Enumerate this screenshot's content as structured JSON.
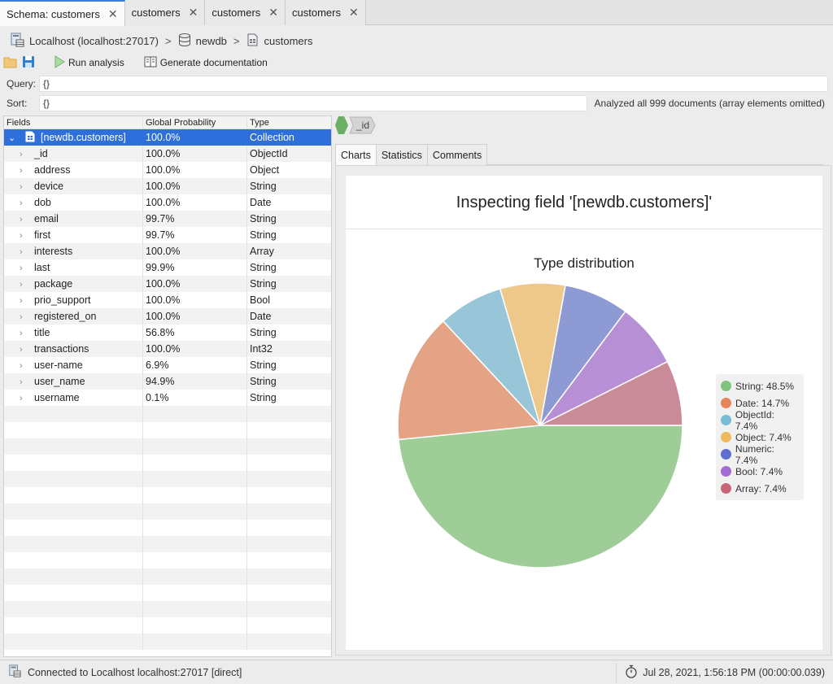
{
  "tabs": [
    {
      "label": "Schema: customers",
      "active": true
    },
    {
      "label": "customers",
      "active": false
    },
    {
      "label": "customers",
      "active": false
    },
    {
      "label": "customers",
      "active": false
    }
  ],
  "breadcrumb": {
    "server": "Localhost (localhost:27017)",
    "database": "newdb",
    "collection": "customers"
  },
  "toolbar": {
    "run_analysis": "Run analysis",
    "generate_documentation": "Generate documentation"
  },
  "query": {
    "label": "Query:",
    "value": "{}"
  },
  "sort": {
    "label": "Sort:",
    "value": "{}"
  },
  "analyzed_text": "Analyzed all 999 documents (array elements omitted)",
  "fields_table": {
    "headers": [
      "Fields",
      "Global Probability",
      "Type"
    ],
    "root": {
      "name": "[newdb.customers]",
      "probability": "100.0%",
      "type": "Collection"
    },
    "rows": [
      {
        "name": "_id",
        "probability": "100.0%",
        "type": "ObjectId"
      },
      {
        "name": "address",
        "probability": "100.0%",
        "type": "Object"
      },
      {
        "name": "device",
        "probability": "100.0%",
        "type": "String"
      },
      {
        "name": "dob",
        "probability": "100.0%",
        "type": "Date"
      },
      {
        "name": "email",
        "probability": "99.7%",
        "type": "String"
      },
      {
        "name": "first",
        "probability": "99.7%",
        "type": "String"
      },
      {
        "name": "interests",
        "probability": "100.0%",
        "type": "Array"
      },
      {
        "name": "last",
        "probability": "99.9%",
        "type": "String"
      },
      {
        "name": "package",
        "probability": "100.0%",
        "type": "String"
      },
      {
        "name": "prio_support",
        "probability": "100.0%",
        "type": "Bool"
      },
      {
        "name": "registered_on",
        "probability": "100.0%",
        "type": "Date"
      },
      {
        "name": "title",
        "probability": "56.8%",
        "type": "String"
      },
      {
        "name": "transactions",
        "probability": "100.0%",
        "type": "Int32"
      },
      {
        "name": "user-name",
        "probability": "6.9%",
        "type": "String"
      },
      {
        "name": "user_name",
        "probability": "94.9%",
        "type": "String"
      },
      {
        "name": "username",
        "probability": "0.1%",
        "type": "String"
      }
    ]
  },
  "field_path": {
    "segment": "_id"
  },
  "right_tabs": [
    {
      "label": "Charts",
      "active": true
    },
    {
      "label": "Statistics",
      "active": false
    },
    {
      "label": "Comments",
      "active": false
    }
  ],
  "inspect_title": "Inspecting field '[newdb.customers]'",
  "chart_data": {
    "type": "pie",
    "title": "Type distribution",
    "categories": [
      "String",
      "Date",
      "ObjectId",
      "Object",
      "Numeric",
      "Bool",
      "Array"
    ],
    "values": [
      48.5,
      14.7,
      7.4,
      7.4,
      7.4,
      7.4,
      7.4
    ],
    "legend_labels": [
      "String: 48.5%",
      "Date: 14.7%",
      "ObjectId: 7.4%",
      "Object: 7.4%",
      "Numeric: 7.4%",
      "Bool: 7.4%",
      "Array: 7.4%"
    ],
    "colors": [
      "#9fcd98",
      "#e4a385",
      "#98c6d8",
      "#edc88a",
      "#8e9ad4",
      "#b68fd4",
      "#c98a9a"
    ],
    "legend_dot_colors": [
      "#7fc47a",
      "#e8845a",
      "#78bcd6",
      "#efb95e",
      "#5f6fd0",
      "#a36ad4",
      "#c96577"
    ],
    "legend": "right",
    "start_direction": "right",
    "direction": "clockwise"
  },
  "status": {
    "connection": "Connected to Localhost localhost:27017 [direct]",
    "timestamp": "Jul 28, 2021, 1:56:18 PM (00:00:00.039)"
  }
}
